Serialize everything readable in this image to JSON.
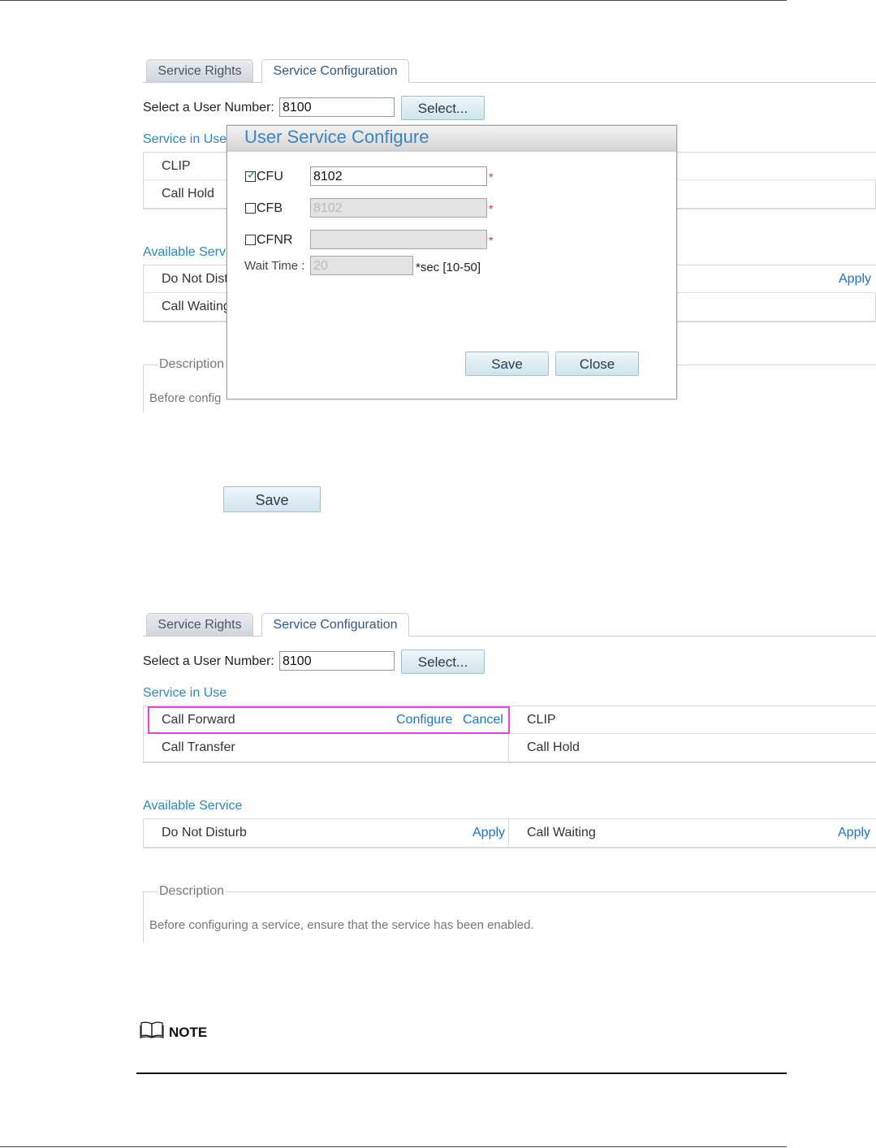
{
  "tabs": [
    "Service Rights",
    "Service Configuration"
  ],
  "user_number_label": "Select a User Number:",
  "user_number_value": "8100",
  "select_button": "Select...",
  "section_in_use": "Service in Use",
  "section_available": "Available Service",
  "description_legend": "Description",
  "description_text": "Before configuring a service, ensure that the service has been enabled.",
  "screen1": {
    "in_use": [
      [
        "CLIP",
        ""
      ],
      [
        "Call Hold",
        ""
      ]
    ],
    "available_partial": [
      "Do Not Dist",
      "Call Waiting"
    ],
    "in_use_trunc": "Service in Use",
    "available_trunc": "Available Serv",
    "description_trunc": "Description",
    "description_text_trunc": "Before config",
    "apply_label": "Apply",
    "bottom_save": "Save"
  },
  "modal": {
    "title": "User Service Configure",
    "cfu_label": "CFU",
    "cfu_checked": true,
    "cfu_value": "8102",
    "cfb_label": "CFB",
    "cfb_checked": false,
    "cfb_value": "8102",
    "cfnr_label": "CFNR",
    "cfnr_checked": false,
    "cfnr_value": "",
    "wait_label": "Wait Time :",
    "wait_value": "20",
    "wait_hint": "*sec [10-50]",
    "required_mark": "*",
    "save": "Save",
    "close": "Close"
  },
  "screen2": {
    "in_use": {
      "call_forward": "Call Forward",
      "configure": "Configure",
      "cancel": "Cancel",
      "clip": "CLIP",
      "call_transfer": "Call Transfer",
      "call_hold": "Call Hold"
    },
    "available": {
      "do_not_disturb": "Do Not Disturb",
      "apply1": "Apply",
      "call_waiting": "Call Waiting",
      "apply2": "Apply"
    }
  },
  "note_label": "NOTE",
  "colors": {
    "link": "#1d74c4",
    "section_title": "#2f86b8",
    "highlight": "#ee3ee8",
    "required": "#e0332b"
  }
}
